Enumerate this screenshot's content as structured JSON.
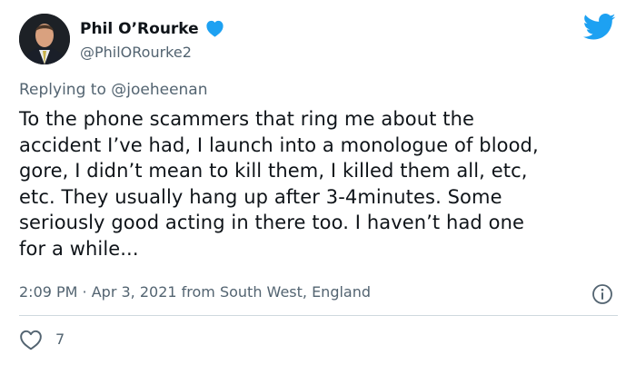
{
  "tweet": {
    "author_name": "Phil O’Rourke",
    "author_handle": "@PhilORourke2",
    "replying_prefix": "Replying to ",
    "replying_to": "@joeheenan",
    "text": "To the phone scammers that ring me about the\naccident I’ve had, I launch into a monologue of blood,\ngore, I didn’t mean to kill them, I killed them all, etc,\netc. They usually hang up after 3-4minutes. Some\nseriously good acting in there too. I haven’t had one\nfor a while...",
    "timestamp": "2:09 PM · Apr 3, 2021 from South West, England",
    "like_count": "7"
  },
  "icons": {
    "verified": "verified-badge-icon",
    "brand": "twitter-bird-icon",
    "info": "info-icon",
    "like": "heart-icon"
  },
  "colors": {
    "brand_blue": "#1da1f2",
    "text_primary": "#0f1419",
    "text_secondary": "#536471",
    "divider": "#cfd9de"
  }
}
